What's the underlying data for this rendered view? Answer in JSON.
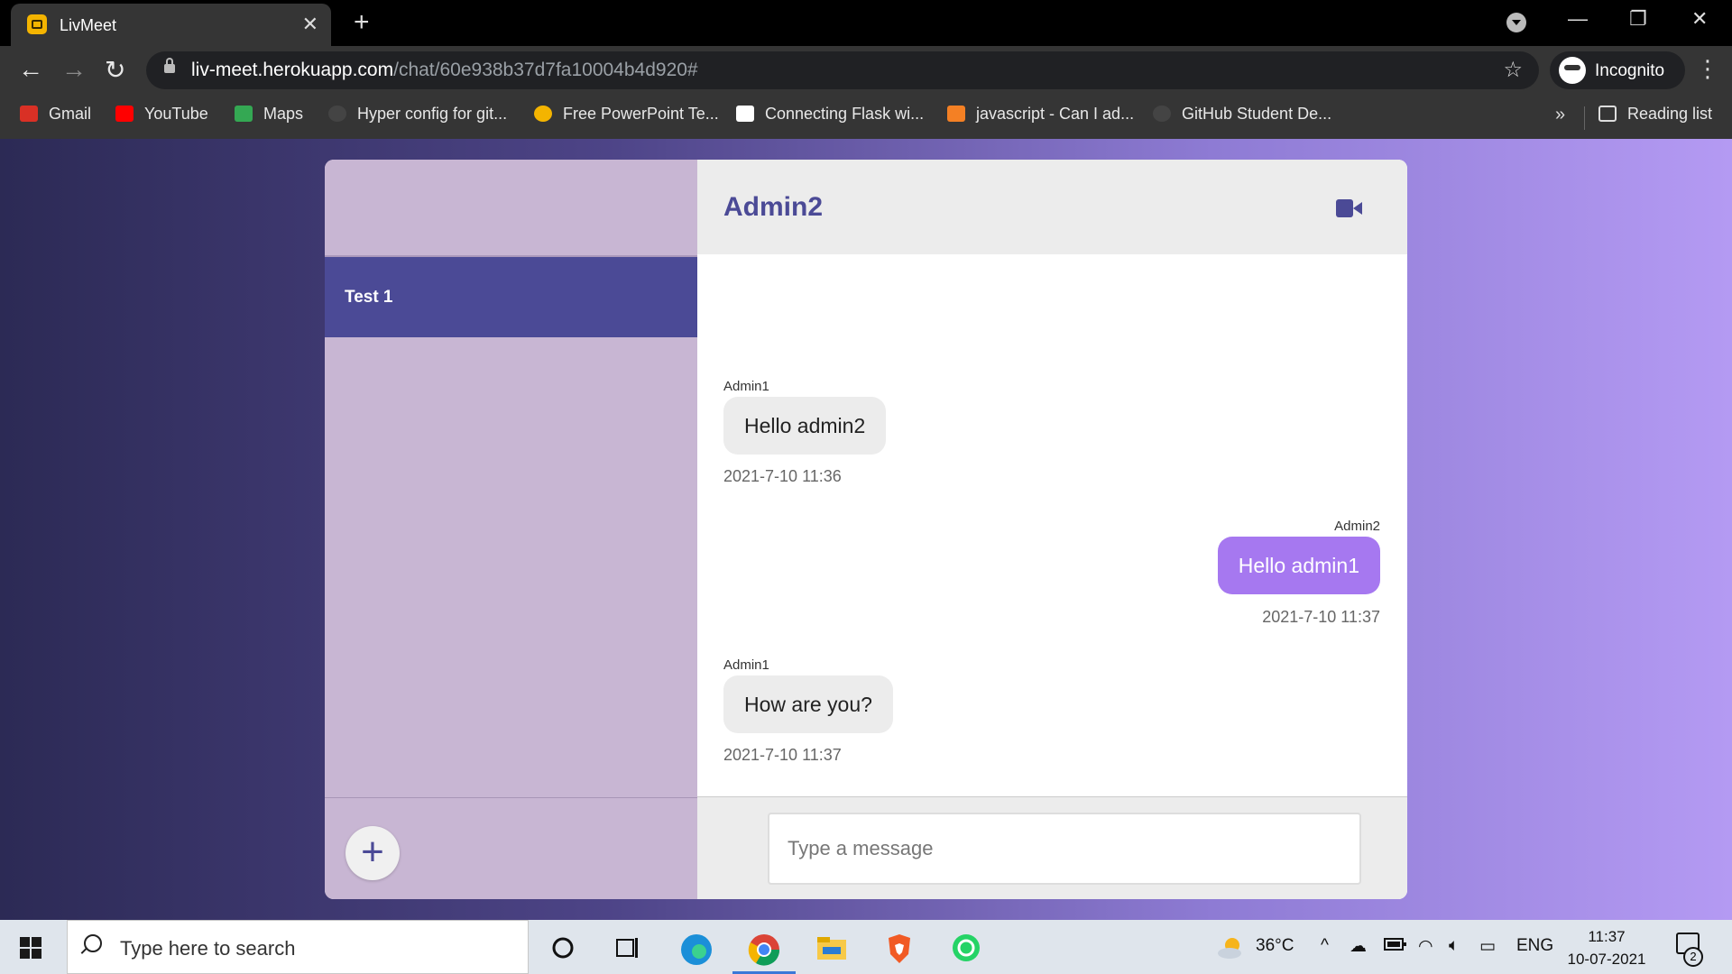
{
  "browser": {
    "tab_title": "LivMeet",
    "url_host": "liv-meet.herokuapp.com",
    "url_path": "/chat/60e938b37d7fa10004b4d920#",
    "profile_label": "Incognito",
    "bookmarks": [
      {
        "label": "Gmail",
        "icon": "gmail-icon",
        "color": "#d93025"
      },
      {
        "label": "YouTube",
        "icon": "youtube-icon",
        "color": "#ff0000"
      },
      {
        "label": "Maps",
        "icon": "maps-icon",
        "color": "#34a853"
      },
      {
        "label": "Hyper config for git...",
        "icon": "github-icon",
        "color": "#444444"
      },
      {
        "label": "Free PowerPoint Te...",
        "icon": "powerpoint-icon",
        "color": "#f4b400"
      },
      {
        "label": "Connecting Flask wi...",
        "icon": "medium-icon",
        "color": "#ffffff"
      },
      {
        "label": "javascript - Can I ad...",
        "icon": "stackoverflow-icon",
        "color": "#f48024"
      },
      {
        "label": "GitHub Student De...",
        "icon": "github-icon",
        "color": "#444444"
      }
    ],
    "more_bookmarks": "»",
    "reading_list": "Reading list"
  },
  "sidebar": {
    "chats": [
      {
        "label": "Test 1"
      }
    ],
    "add_symbol": "+"
  },
  "chat": {
    "contact_name": "Admin2",
    "messages": [
      {
        "sender": "Admin1",
        "text": "Hello admin2",
        "timestamp": "2021-7-10 11:36",
        "direction": "incoming"
      },
      {
        "sender": "Admin2",
        "text": "Hello admin1",
        "timestamp": "2021-7-10 11:37",
        "direction": "outgoing"
      },
      {
        "sender": "Admin1",
        "text": "How are you?",
        "timestamp": "2021-7-10 11:37",
        "direction": "incoming"
      }
    ],
    "input_placeholder": "Type a message"
  },
  "colors": {
    "accent": "#4b4a96",
    "outgoing_bubble": "#a678f0",
    "incoming_bubble": "#ececec",
    "sidebar": "#c8b6d3"
  },
  "taskbar": {
    "search_placeholder": "Type here to search",
    "temperature": "36°C",
    "language": "ENG",
    "time": "11:37",
    "date": "10-07-2021",
    "notification_count": "2"
  }
}
